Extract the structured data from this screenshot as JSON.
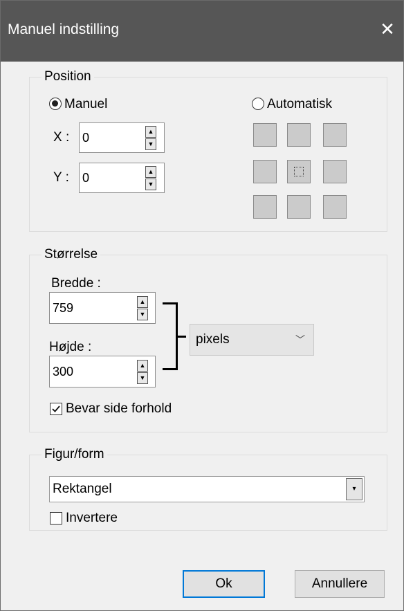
{
  "window": {
    "title": "Manuel indstilling",
    "close_glyph": "✕"
  },
  "position": {
    "legend": "Position",
    "manual_label": "Manuel",
    "auto_label": "Automatisk",
    "manual_selected": true,
    "x_label": "X :",
    "x_value": "0",
    "y_label": "Y :",
    "y_value": "0",
    "anchor_selected": "center"
  },
  "size": {
    "legend": "Størrelse",
    "width_label": "Bredde :",
    "width_value": "759",
    "height_label": "Højde :",
    "height_value": "300",
    "unit": "pixels",
    "keep_ratio_label": "Bevar side forhold",
    "keep_ratio_checked": true
  },
  "shape": {
    "legend": "Figur/form",
    "value": "Rektangel",
    "invert_label": "Invertere",
    "invert_checked": false
  },
  "buttons": {
    "ok": "Ok",
    "cancel": "Annullere"
  },
  "icons": {
    "close": "close-icon",
    "spin_up": "▲",
    "spin_down": "▼",
    "dropdown": "▾",
    "chevron": "﹀"
  }
}
